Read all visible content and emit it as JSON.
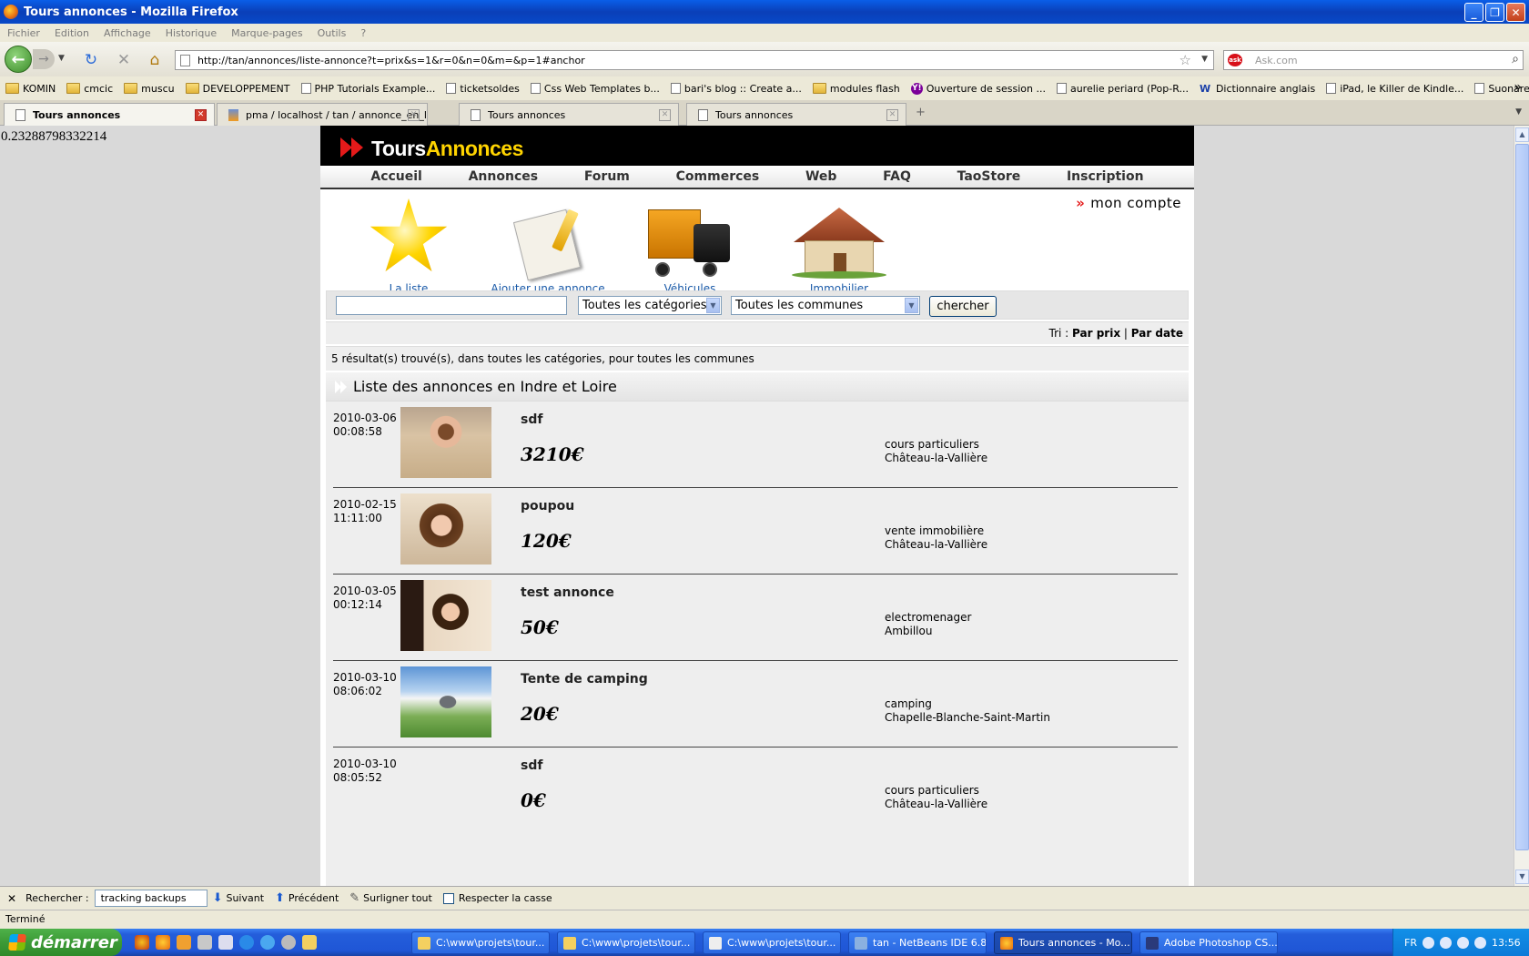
{
  "window": {
    "title": "Tours annonces - Mozilla Firefox"
  },
  "menu": [
    "Fichier",
    "Edition",
    "Affichage",
    "Historique",
    "Marque-pages",
    "Outils",
    "?"
  ],
  "navbar": {
    "url": "http://tan/annonces/liste-annonce?t=prix&s=1&r=0&n=0&m=&p=1#anchor",
    "search_placeholder": "Ask.com",
    "search_engine": "Ask"
  },
  "bookmarks": [
    {
      "label": "KOMIN",
      "icon": "folder"
    },
    {
      "label": "cmcic",
      "icon": "folder"
    },
    {
      "label": "muscu",
      "icon": "folder"
    },
    {
      "label": "DEVELOPPEMENT",
      "icon": "folder"
    },
    {
      "label": "PHP Tutorials Example...",
      "icon": "page"
    },
    {
      "label": "ticketsoldes",
      "icon": "page"
    },
    {
      "label": "Css Web Templates b...",
      "icon": "page"
    },
    {
      "label": "bari's blog :: Create a...",
      "icon": "page"
    },
    {
      "label": "modules flash",
      "icon": "folder"
    },
    {
      "label": "Ouverture de session ...",
      "icon": "yahoo"
    },
    {
      "label": "aurelie periard (Pop-R...",
      "icon": "page"
    },
    {
      "label": "Dictionnaire anglais",
      "icon": "wr"
    },
    {
      "label": "iPad, le Killer de Kindle...",
      "icon": "page"
    },
    {
      "label": "Suonare e Cantare su...",
      "icon": "page"
    }
  ],
  "tabs": [
    {
      "label": "Tours annonces",
      "active": true
    },
    {
      "label": "pma / localhost / tan / annonce_en_lign...",
      "active": false
    },
    {
      "label": "Tours annonces",
      "active": false
    },
    {
      "label": "Tours annonces",
      "active": false
    }
  ],
  "page": {
    "random_number": "0.23288798332214",
    "logo": {
      "part1": "Tours",
      "part2": "Annonces"
    },
    "nav": [
      "Accueil",
      "Annonces",
      "Forum",
      "Commerces",
      "Web",
      "FAQ",
      "TaoStore",
      "Inscription"
    ],
    "mon_compte": "mon compte",
    "categories": [
      {
        "label": "La liste",
        "icon": "star-icon"
      },
      {
        "label": "Ajouter une annonce",
        "icon": "document-pen-icon"
      },
      {
        "label": "Véhicules",
        "icon": "truck-icon"
      },
      {
        "label": "Immobilier",
        "icon": "house-icon"
      }
    ],
    "search": {
      "query": "",
      "category": "Toutes les catégories",
      "commune": "Toutes les communes",
      "button": "chercher"
    },
    "sort": {
      "label": "Tri :",
      "by_price": "Par prix",
      "separator": "|",
      "by_date": "Par date"
    },
    "results_text": "5 résultat(s) trouvé(s), dans toutes les catégories, pour toutes les communes",
    "list_title": "Liste des annonces en Indre et Loire",
    "listings": [
      {
        "date": "2010-03-06",
        "time": "00:08:58",
        "title": "sdf",
        "price": "3210€",
        "category": "cours particuliers",
        "commune": "Château-la-Vallière",
        "photo": "ph1"
      },
      {
        "date": "2010-02-15",
        "time": "11:11:00",
        "title": "poupou",
        "price": "120€",
        "category": "vente immobilière",
        "commune": "Château-la-Vallière",
        "photo": "ph2"
      },
      {
        "date": "2010-03-05",
        "time": "00:12:14",
        "title": "test annonce",
        "price": "50€",
        "category": "electromenager",
        "commune": "Ambillou",
        "photo": "ph3"
      },
      {
        "date": "2010-03-10",
        "time": "08:06:02",
        "title": "Tente de camping",
        "price": "20€",
        "category": "camping",
        "commune": "Chapelle-Blanche-Saint-Martin",
        "photo": "ph4"
      },
      {
        "date": "2010-03-10",
        "time": "08:05:52",
        "title": "sdf",
        "price": "0€",
        "category": "cours particuliers",
        "commune": "Château-la-Vallière",
        "photo": ""
      }
    ]
  },
  "findbar": {
    "label": "Rechercher :",
    "value": "tracking backups",
    "next": "Suivant",
    "prev": "Précédent",
    "highlight": "Surligner tout",
    "match_case": "Respecter la casse"
  },
  "status": "Terminé",
  "taskbar": {
    "start": "démarrer",
    "buttons": [
      "C:\\www\\projets\\tour...",
      "C:\\www\\projets\\tour...",
      "C:\\www\\projets\\tour...",
      "tan - NetBeans IDE 6.8",
      "Tours annonces - Mo...",
      "Adobe Photoshop CS..."
    ],
    "lang": "FR",
    "clock": "13:56"
  }
}
